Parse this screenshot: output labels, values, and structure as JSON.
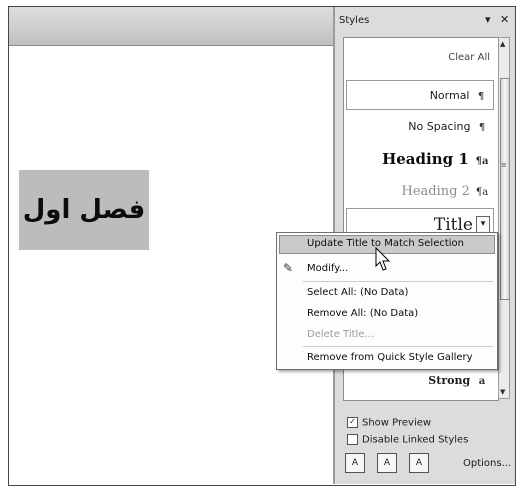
{
  "document": {
    "heading_text": "فصل اول"
  },
  "styles_pane": {
    "title": "Styles",
    "dropdown_glyph": "▾",
    "close_glyph": "✕",
    "clear_all": "Clear All",
    "items": [
      {
        "label": "Normal",
        "mark": "¶"
      },
      {
        "label": "No Spacing",
        "mark": "¶"
      },
      {
        "label": "Heading 1",
        "mark": "¶a"
      },
      {
        "label": "Heading 2",
        "mark": "¶a"
      },
      {
        "label": "Title",
        "mark": "▾"
      },
      {
        "label": "Strong",
        "mark": "a"
      }
    ],
    "show_preview": {
      "label": "Show Preview",
      "checked": true,
      "glyph": "✓"
    },
    "disable_linked": {
      "label": "Disable Linked Styles",
      "checked": false
    },
    "buttons": [
      "A",
      "A",
      "A"
    ],
    "options": "Options..."
  },
  "context_menu": {
    "items": [
      {
        "label": "Update Title to Match Selection",
        "enabled": true,
        "highlighted": true
      },
      {
        "label": "Modify...",
        "enabled": true
      },
      {
        "label": "Select All: (No Data)",
        "enabled": true
      },
      {
        "label": "Remove All: (No Data)",
        "enabled": true
      },
      {
        "label": "Delete Title...",
        "enabled": false
      },
      {
        "label": "Remove from Quick Style Gallery",
        "enabled": true
      }
    ]
  },
  "colors": {
    "pane_bg": "#d8d8d8",
    "heading_box": "#b9b9b9",
    "menu_highlight": "#c6c6c6",
    "disabled_text": "#9a9a9a"
  }
}
